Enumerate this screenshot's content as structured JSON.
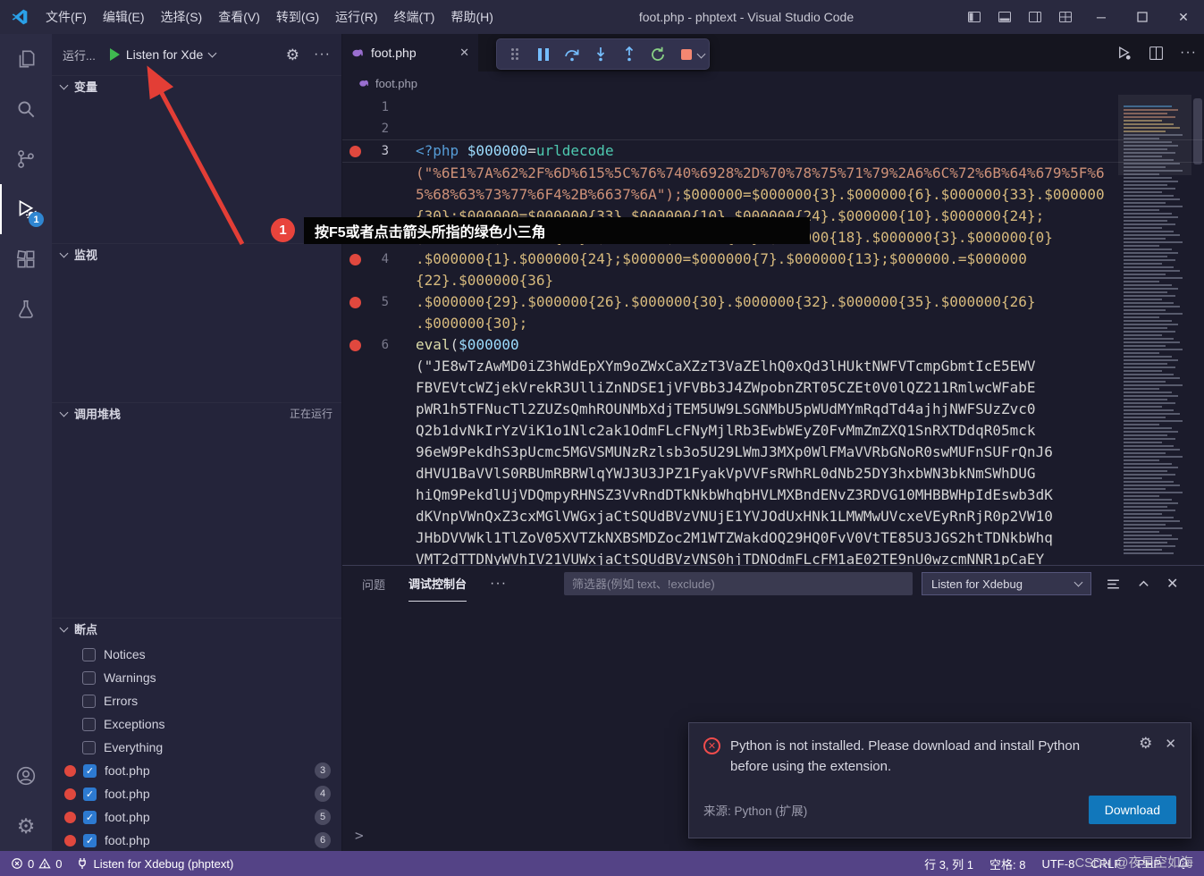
{
  "titlebar": {
    "title": "foot.php - phptext - Visual Studio Code",
    "menus": [
      "文件(F)",
      "编辑(E)",
      "选择(S)",
      "查看(V)",
      "转到(G)",
      "运行(R)",
      "终端(T)",
      "帮助(H)"
    ]
  },
  "activity_bar": {
    "debug_badge": "1"
  },
  "sidebar": {
    "title": "运行...",
    "launch_config": "Listen for Xde",
    "sections": {
      "variables": "变量",
      "watch": "监视",
      "call_stack": "调用堆栈",
      "call_stack_status": "正在运行",
      "breakpoints": "断点"
    },
    "breakpoint_filters": [
      "Notices",
      "Warnings",
      "Errors",
      "Exceptions",
      "Everything"
    ],
    "breakpoints": [
      {
        "file": "foot.php",
        "line": "3"
      },
      {
        "file": "foot.php",
        "line": "4"
      },
      {
        "file": "foot.php",
        "line": "5"
      },
      {
        "file": "foot.php",
        "line": "6"
      }
    ]
  },
  "editor": {
    "tab": "foot.php",
    "breadcrumb": "foot.php",
    "lines": [
      {
        "num": "1",
        "bp": false,
        "rows": [
          []
        ]
      },
      {
        "num": "2",
        "bp": false,
        "rows": [
          []
        ]
      },
      {
        "num": "3",
        "bp": true,
        "active": true,
        "current": true,
        "rows": [
          [
            {
              "t": "<?php ",
              "c": "kw"
            },
            {
              "t": "$000000",
              "c": "var"
            },
            {
              "t": "=",
              "c": "plain"
            },
            {
              "t": "urldecode",
              "c": "fn"
            }
          ],
          [
            {
              "t": "(\"%6E1%7A%62%2F%6D%615%5C%76%740%6928%2D%70%78%75%71%79%2A6%6C%72%6B%64%679%5F%6",
              "c": "str"
            }
          ],
          [
            {
              "t": "5%68%63%73%77%6F4%2B%6637%6A\");",
              "c": "str"
            },
            {
              "t": "$000000=$000000{3}.$000000{6}.$000000{33}.$000000",
              "c": "gold"
            }
          ],
          [
            {
              "t": "{30};$000000=$000000{33}.$000000{10}.$000000{24}.$000000{10}.$000000{24};",
              "c": "gold"
            }
          ],
          [
            {
              "t": "$000000.=$000000{24};$000000=$000000{26}.$000000{18}.$000000{3}.$000000{0}",
              "c": "gold"
            }
          ]
        ]
      },
      {
        "num": "4",
        "bp": true,
        "rows": [
          [
            {
              "t": ".$000000{1}.$000000{24};$000000=$000000{7}.$000000{13};$000000.=$000000",
              "c": "gold"
            }
          ],
          [
            {
              "t": "{22}.$000000{36}",
              "c": "gold"
            }
          ]
        ]
      },
      {
        "num": "5",
        "bp": true,
        "rows": [
          [
            {
              "t": ".$000000{29}.$000000{26}.$000000{30}.$000000{32}.$000000{35}.$000000{26}",
              "c": "gold"
            }
          ],
          [
            {
              "t": ".$000000{30};",
              "c": "gold"
            }
          ]
        ]
      },
      {
        "num": "6",
        "bp": true,
        "rows": [
          [
            {
              "t": "eval",
              "c": "fn2"
            },
            {
              "t": "(",
              "c": "plain"
            },
            {
              "t": "$000000",
              "c": "var"
            }
          ],
          [
            {
              "t": "(\"JE8wTzAwMD0iZ3hWdEpXYm9oZWxCaXZzT3VaZElhQ0xQd3lHUktNWFVTcmpGbmtIcE5EWV",
              "c": "b64"
            }
          ],
          [
            {
              "t": "FBVEVtcWZjekVrekR3UlliZnNDSE1jVFVBb3J4ZWpobnZRT05CZEt0V0lQZ211RmlwcWFabE",
              "c": "b64"
            }
          ],
          [
            {
              "t": "pWR1h5TFNucTl2ZUZsQmhROUNMbXdjTEM5UW9LSGNMbU5pWUdMYmRqdTd4ajhjNWFSUzZvc0",
              "c": "b64"
            }
          ],
          [
            {
              "t": "Q2b1dvNkIrYzViK1o1Nlc2ak1OdmFLcFNyMjlRb3EwbWEyZ0FvMmZmZXQ1SnRXTDdqR05mck",
              "c": "b64"
            }
          ],
          [
            {
              "t": "96eW9PekdhS3pUcmc5MGVSMUNzRzlsb3o5U29LWmJ3MXp0WlFMaVVRbGNoR0swMUFnSUFrQnJ6",
              "c": "b64"
            }
          ],
          [
            {
              "t": "dHVU1BaVVlS0RBUmRBRWlqYWJ3U3JPZ1FyakVpVVFsRWhRL0dNb25DY3hxbWN3bkNmSWhDUG",
              "c": "b64"
            }
          ],
          [
            {
              "t": "hiQm9PekdlUjVDQmpyRHNSZ3VvRndDTkNkbWhqbHVLMXBndENvZ3RDVG10MHBBWHpIdEswb3dK",
              "c": "b64"
            }
          ],
          [
            {
              "t": "dKVnpVWnQxZ3cxMGlVWGxjaCtSQUdBVzVNUjE1YVJOdUxHNk1LMWMwUVcxeVEyRnRjR0p2VW10",
              "c": "b64"
            }
          ],
          [
            {
              "t": "JHbDVVWkl1TlZoV05XVTZkNXBSMDZoc2M1WTZWakdOQ29HQ0FvV0VtTE85U3JGS2htTDNkbWhq",
              "c": "b64"
            }
          ],
          [
            {
              "t": "VMT2dTTDNyWVhIV21VUWxjaCtSQUdBVzVNS0hjTDNOdmFLcFM1aE02TE9nU0wzcmNNR1pCaEY",
              "c": "b64"
            }
          ]
        ]
      }
    ]
  },
  "annotation": {
    "badge": "1",
    "tooltip": "按F5或者点击箭头所指的绿色小三角"
  },
  "panel": {
    "tabs": [
      "问题",
      "调试控制台"
    ],
    "filter_placeholder": "筛选器(例如 text、!exclude)",
    "launch_dropdown": "Listen for Xdebug",
    "prompt": ">"
  },
  "notification": {
    "message": "Python is not installed. Please download and install Python before using the extension.",
    "source": "来源: Python (扩展)",
    "download_label": "Download"
  },
  "status_bar": {
    "errors": "0",
    "warnings": "0",
    "debug_status": "Listen for Xdebug (phptext)",
    "line_col": "行 3, 列 1",
    "indent": "空格: 8",
    "encoding": "UTF-8",
    "eol": "CRLF",
    "language": "PHP"
  },
  "watermark": "CSDN @夜星空如海",
  "colors": {
    "accent_button": "#1177bb",
    "status_bar_purple": "#544386",
    "breakpoint_red": "#e0483e",
    "annotation_red": "#e8443c",
    "run_green": "#3fba50",
    "php_icon_purple": "#9a6fd0",
    "error_red": "#f14c4c"
  }
}
